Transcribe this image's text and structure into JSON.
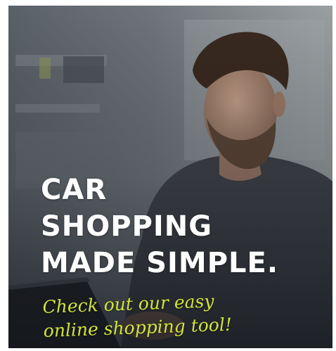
{
  "ad": {
    "headline_lines": [
      "CAR",
      "SHOPPING",
      "MADE SIMPLE."
    ],
    "tagline_lines": [
      "Check out our easy",
      "online shopping tool!"
    ],
    "colors": {
      "headline": "#ffffff",
      "tagline": "#d2e43c",
      "overlay": "#2b3037"
    },
    "photo_subject": "bearded-man-using-laptop"
  }
}
